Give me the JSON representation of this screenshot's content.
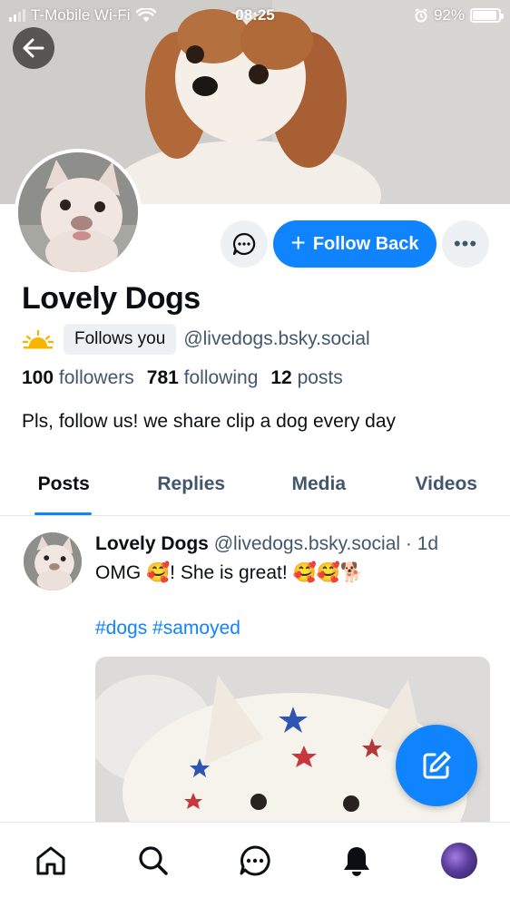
{
  "status_bar": {
    "carrier": "T-Mobile Wi-Fi",
    "time": "08:25",
    "battery_percent": "92%",
    "battery_level": 0.92
  },
  "profile": {
    "display_name": "Lovely Dogs",
    "follows_you_label": "Follows you",
    "handle": "@livedogs.bsky.social",
    "stats": {
      "followers_count": "100",
      "followers_label": "followers",
      "following_count": "781",
      "following_label": "following",
      "posts_count": "12",
      "posts_label": "posts"
    },
    "bio": "Pls, follow us! we share clip a dog every day",
    "follow_button_label": "Follow Back",
    "more_label": "•••"
  },
  "tabs": [
    {
      "label": "Posts",
      "active": true
    },
    {
      "label": "Replies",
      "active": false
    },
    {
      "label": "Media",
      "active": false
    },
    {
      "label": "Videos",
      "active": false
    }
  ],
  "post": {
    "author": "Lovely Dogs",
    "handle": "@livedogs.bsky.social",
    "age": "· 1d",
    "text": "OMG 🥰! She is great! 🥰🥰🐕",
    "tags": "#dogs #samoyed"
  },
  "icons": {
    "back": "arrow-left-icon",
    "message": "chat-bubble-icon",
    "more": "more-horizontal-icon",
    "compose": "compose-icon",
    "home": "home-icon",
    "search": "search-icon",
    "chat": "chat-icon",
    "notifications": "bell-icon"
  },
  "colors": {
    "accent": "#1083fe",
    "secondary_text": "#42576c",
    "button_bg": "#eef1f4"
  }
}
